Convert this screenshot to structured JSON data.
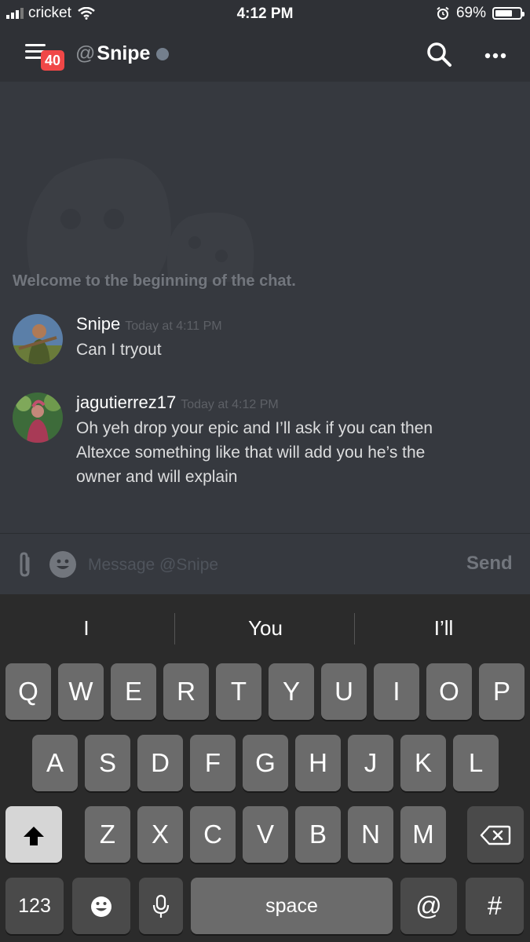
{
  "status_bar": {
    "carrier": "cricket",
    "time": "4:12 PM",
    "battery": "69%",
    "battery_level": 0.69
  },
  "header": {
    "unread_badge": "40",
    "at_symbol": "@",
    "channel_name": "Snipe"
  },
  "chat": {
    "welcome_text": "Welcome to the beginning of the chat.",
    "messages": [
      {
        "author": "Snipe",
        "timestamp": "Today at 4:11 PM",
        "lines": [
          "Can I tryout"
        ]
      },
      {
        "author": "jagutierrez17",
        "timestamp": "Today at 4:12 PM",
        "lines": [
          "Oh yeh drop your epic and I’ll ask if you can then",
          "Altexce something like that will add you he’s the",
          "owner and will explain"
        ]
      }
    ]
  },
  "input": {
    "placeholder": "Message @Snipe",
    "send_label": "Send"
  },
  "keyboard": {
    "suggestions": [
      "I",
      "You",
      "I’ll"
    ],
    "row1": [
      "Q",
      "W",
      "E",
      "R",
      "T",
      "Y",
      "U",
      "I",
      "O",
      "P"
    ],
    "row2": [
      "A",
      "S",
      "D",
      "F",
      "G",
      "H",
      "J",
      "K",
      "L"
    ],
    "row3": [
      "Z",
      "X",
      "C",
      "V",
      "B",
      "N",
      "M"
    ],
    "numbers_key": "123",
    "space_key": "space",
    "at_key": "@",
    "hash_key": "#",
    "icons": {
      "shift": "shift-icon",
      "backspace": "backspace-icon",
      "emoji": "emoji-icon",
      "mic": "microphone-icon"
    }
  },
  "colors": {
    "background": "#36393f",
    "header": "#2f3136",
    "badge": "#f04747",
    "keyboard": "#2b2b2b"
  }
}
